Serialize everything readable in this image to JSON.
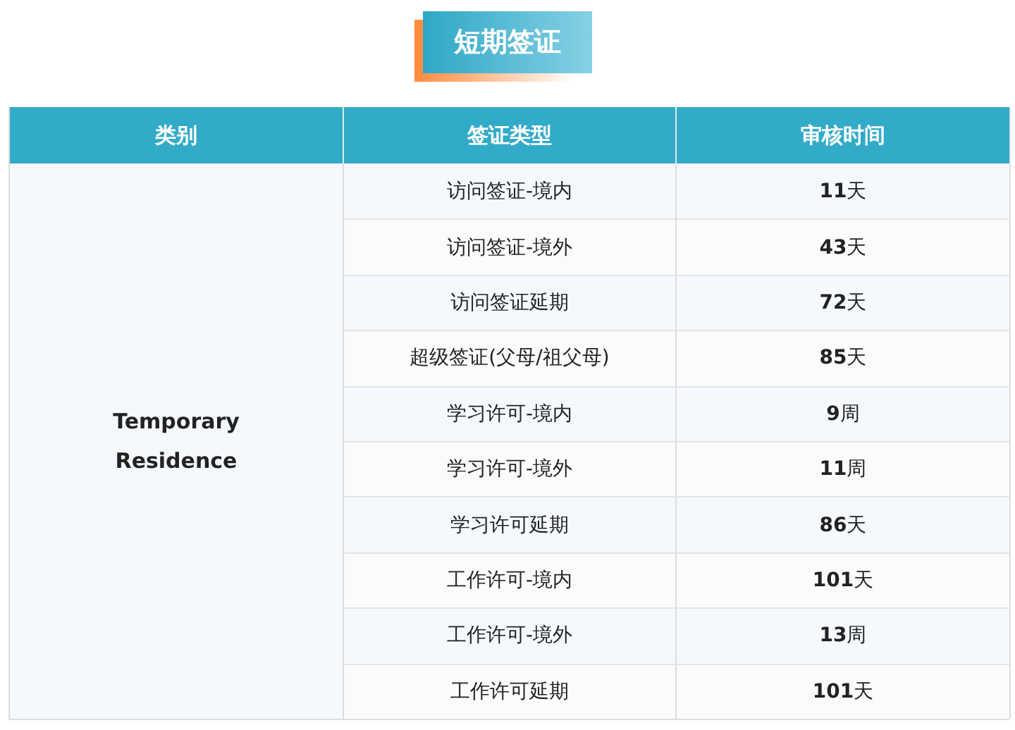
{
  "title": "短期签证",
  "table": {
    "columns": [
      "类别",
      "签证类型",
      "审核时间"
    ],
    "category": "Temporary Residence",
    "rows": [
      {
        "visa_type": "访问签证-境内",
        "time": "**11**天"
      },
      {
        "visa_type": "访问签证-境外",
        "time": "**43**天"
      },
      {
        "visa_type": "访问签证延期",
        "time": "**72**天"
      },
      {
        "visa_type": "超级签证(父母/祖父母)",
        "time": "**85**天"
      },
      {
        "visa_type": "学习许可-境内",
        "time": "**9**周"
      },
      {
        "visa_type": "学习许可-境外",
        "time": "**11**周"
      },
      {
        "visa_type": "学习许可延期",
        "time": "**86**天"
      },
      {
        "visa_type": "工作许可-境内",
        "time": "**101**天"
      },
      {
        "visa_type": "工作许可-境外",
        "time": "**13**周"
      },
      {
        "visa_type": "工作许可延期",
        "time": "**101**天"
      }
    ]
  }
}
